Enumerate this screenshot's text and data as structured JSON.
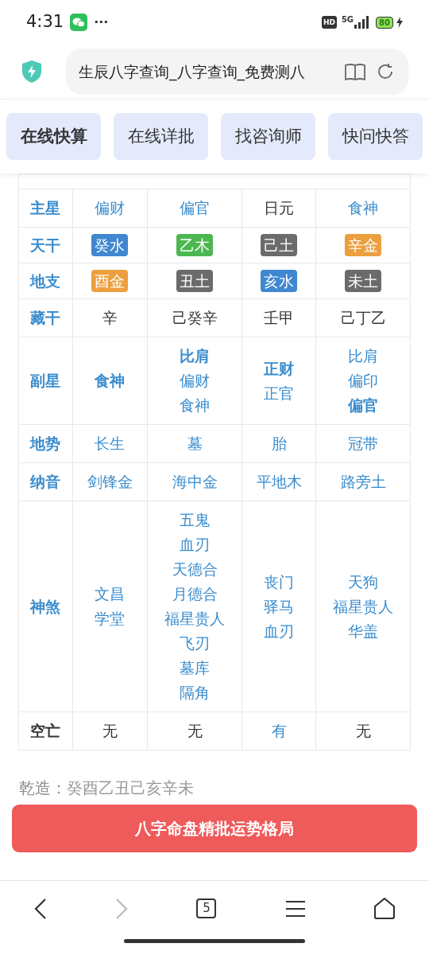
{
  "status_bar": {
    "time": "4:31",
    "more": "···",
    "hd": "HD",
    "network": "5G",
    "battery": "80"
  },
  "address_bar": {
    "title": "生辰八字查询_八字查询_免费测八"
  },
  "tabs": [
    {
      "label": "在线快算",
      "selected": true
    },
    {
      "label": "在线详批",
      "selected": false
    },
    {
      "label": "找咨询师",
      "selected": false
    },
    {
      "label": "快问快答",
      "selected": false
    }
  ],
  "table": {
    "rows": [
      {
        "label": "主星",
        "label_accent": true,
        "cells": [
          {
            "kind": "text",
            "accent": true,
            "lines": [
              {
                "text": "偏财",
                "bold": false
              }
            ]
          },
          {
            "kind": "text",
            "accent": true,
            "lines": [
              {
                "text": "偏官",
                "bold": false
              }
            ]
          },
          {
            "kind": "text",
            "accent": false,
            "lines": [
              {
                "text": "日元",
                "bold": false
              }
            ]
          },
          {
            "kind": "text",
            "accent": true,
            "lines": [
              {
                "text": "食神",
                "bold": false
              }
            ]
          }
        ]
      },
      {
        "label": "天干",
        "label_accent": true,
        "cells": [
          {
            "kind": "tag",
            "text": "癸水",
            "color": "#3f87d1"
          },
          {
            "kind": "tag",
            "text": "乙木",
            "color": "#4cb751"
          },
          {
            "kind": "tag",
            "text": "己土",
            "color": "#6b6b6b"
          },
          {
            "kind": "tag",
            "text": "辛金",
            "color": "#ec9f3e"
          }
        ]
      },
      {
        "label": "地支",
        "label_accent": true,
        "cells": [
          {
            "kind": "tag",
            "text": "酉金",
            "color": "#ec9f3e"
          },
          {
            "kind": "tag",
            "text": "丑土",
            "color": "#6b6b6b"
          },
          {
            "kind": "tag",
            "text": "亥水",
            "color": "#3f87d1"
          },
          {
            "kind": "tag",
            "text": "未土",
            "color": "#6b6b6b"
          }
        ]
      },
      {
        "label": "藏干",
        "label_accent": true,
        "cells": [
          {
            "kind": "text",
            "accent": false,
            "lines": [
              {
                "text": "辛",
                "bold": false
              }
            ]
          },
          {
            "kind": "text",
            "accent": false,
            "lines": [
              {
                "text": "己癸辛",
                "bold": false
              }
            ]
          },
          {
            "kind": "text",
            "accent": false,
            "lines": [
              {
                "text": "壬甲",
                "bold": false
              }
            ]
          },
          {
            "kind": "text",
            "accent": false,
            "lines": [
              {
                "text": "己丁乙",
                "bold": false
              }
            ]
          }
        ]
      },
      {
        "label": "副星",
        "label_accent": true,
        "cells": [
          {
            "kind": "text",
            "accent": true,
            "lines": [
              {
                "text": "食神",
                "bold": true
              }
            ]
          },
          {
            "kind": "text",
            "accent": true,
            "lines": [
              {
                "text": "比肩",
                "bold": true
              },
              {
                "text": "偏财",
                "bold": false
              },
              {
                "text": "食神",
                "bold": false
              }
            ]
          },
          {
            "kind": "text",
            "accent": true,
            "lines": [
              {
                "text": "正财",
                "bold": true
              },
              {
                "text": "正官",
                "bold": false
              }
            ]
          },
          {
            "kind": "text",
            "accent": true,
            "lines": [
              {
                "text": "比肩",
                "bold": false
              },
              {
                "text": "偏印",
                "bold": false
              },
              {
                "text": "偏官",
                "bold": true
              }
            ]
          }
        ]
      },
      {
        "label": "地势",
        "label_accent": true,
        "cells": [
          {
            "kind": "text",
            "accent": true,
            "lines": [
              {
                "text": "长生",
                "bold": false
              }
            ]
          },
          {
            "kind": "text",
            "accent": true,
            "lines": [
              {
                "text": "墓",
                "bold": false
              }
            ]
          },
          {
            "kind": "text",
            "accent": true,
            "lines": [
              {
                "text": "胎",
                "bold": false
              }
            ]
          },
          {
            "kind": "text",
            "accent": true,
            "lines": [
              {
                "text": "冠带",
                "bold": false
              }
            ]
          }
        ]
      },
      {
        "label": "纳音",
        "label_accent": true,
        "cells": [
          {
            "kind": "text",
            "accent": true,
            "lines": [
              {
                "text": "剑锋金",
                "bold": false
              }
            ]
          },
          {
            "kind": "text",
            "accent": true,
            "lines": [
              {
                "text": "海中金",
                "bold": false
              }
            ]
          },
          {
            "kind": "text",
            "accent": true,
            "lines": [
              {
                "text": "平地木",
                "bold": false
              }
            ]
          },
          {
            "kind": "text",
            "accent": true,
            "lines": [
              {
                "text": "路旁土",
                "bold": false
              }
            ]
          }
        ]
      },
      {
        "label": "神煞",
        "label_accent": true,
        "cells": [
          {
            "kind": "text",
            "accent": true,
            "lines": [
              {
                "text": "文昌",
                "bold": false
              },
              {
                "text": "学堂",
                "bold": false
              }
            ]
          },
          {
            "kind": "text",
            "accent": true,
            "lines": [
              {
                "text": "五鬼",
                "bold": false
              },
              {
                "text": "血刃",
                "bold": false
              },
              {
                "text": "天德合",
                "bold": false
              },
              {
                "text": "月德合",
                "bold": false
              },
              {
                "text": "福星贵人",
                "bold": false
              },
              {
                "text": "飞刃",
                "bold": false
              },
              {
                "text": "墓库",
                "bold": false
              },
              {
                "text": "隔角",
                "bold": false
              }
            ]
          },
          {
            "kind": "text",
            "accent": true,
            "lines": [
              {
                "text": "丧门",
                "bold": false
              },
              {
                "text": "驿马",
                "bold": false
              },
              {
                "text": "血刃",
                "bold": false
              }
            ]
          },
          {
            "kind": "text",
            "accent": true,
            "lines": [
              {
                "text": "天狗",
                "bold": false
              },
              {
                "text": "福星贵人",
                "bold": false
              },
              {
                "text": "华盖",
                "bold": false
              }
            ]
          }
        ]
      },
      {
        "label": "空亡",
        "label_accent": false,
        "cells": [
          {
            "kind": "text",
            "accent": false,
            "lines": [
              {
                "text": "无",
                "bold": false
              }
            ]
          },
          {
            "kind": "text",
            "accent": false,
            "lines": [
              {
                "text": "无",
                "bold": false
              }
            ]
          },
          {
            "kind": "text",
            "accent": true,
            "lines": [
              {
                "text": "有",
                "bold": false
              }
            ]
          },
          {
            "kind": "text",
            "accent": false,
            "lines": [
              {
                "text": "无",
                "bold": false
              }
            ]
          }
        ]
      }
    ]
  },
  "chart_summary": {
    "label": "乾造：",
    "value": "癸酉乙丑己亥辛未"
  },
  "cta_button": "八字命盘精批运势格局",
  "bottom_nav": {
    "tab_count": "5"
  }
}
